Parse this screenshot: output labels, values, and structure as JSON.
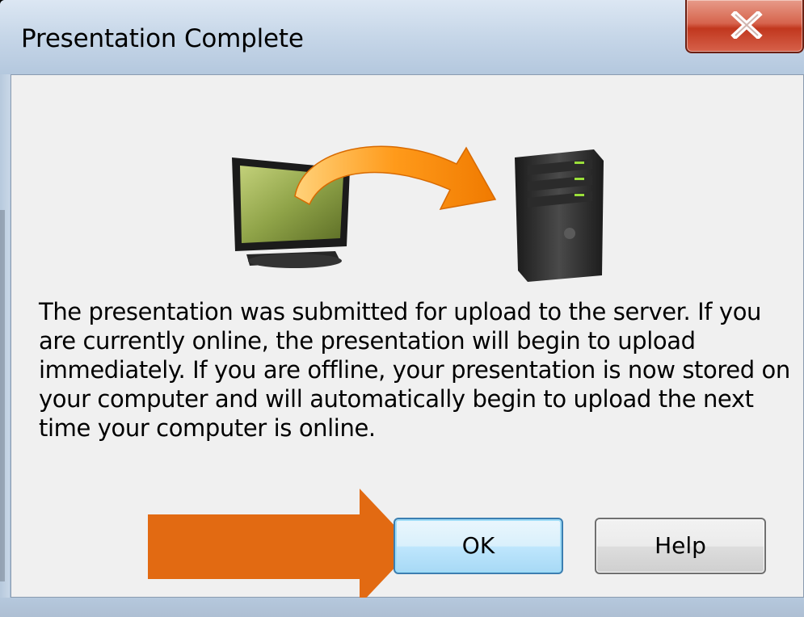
{
  "dialog": {
    "title": "Presentation Complete",
    "close_icon": "close-x-icon",
    "illustration": {
      "source_icon": "monitor-icon",
      "transfer_icon": "curved-arrow-icon",
      "target_icon": "server-icon"
    },
    "message": "The presentation was submitted for upload to the server. If you are currently online, the presentation will begin to upload immediately. If you are offline, your presentation is now stored on your computer and will automatically begin to upload the next time your computer is online.",
    "buttons": {
      "ok_label": "OK",
      "help_label": "Help"
    }
  },
  "annotation": {
    "pointer_icon": "callout-arrow-icon",
    "color": "#e26a12"
  },
  "colors": {
    "close_button": "#c8432a",
    "dialog_background": "#f0f0f0",
    "frame": "#b8cbe0"
  }
}
